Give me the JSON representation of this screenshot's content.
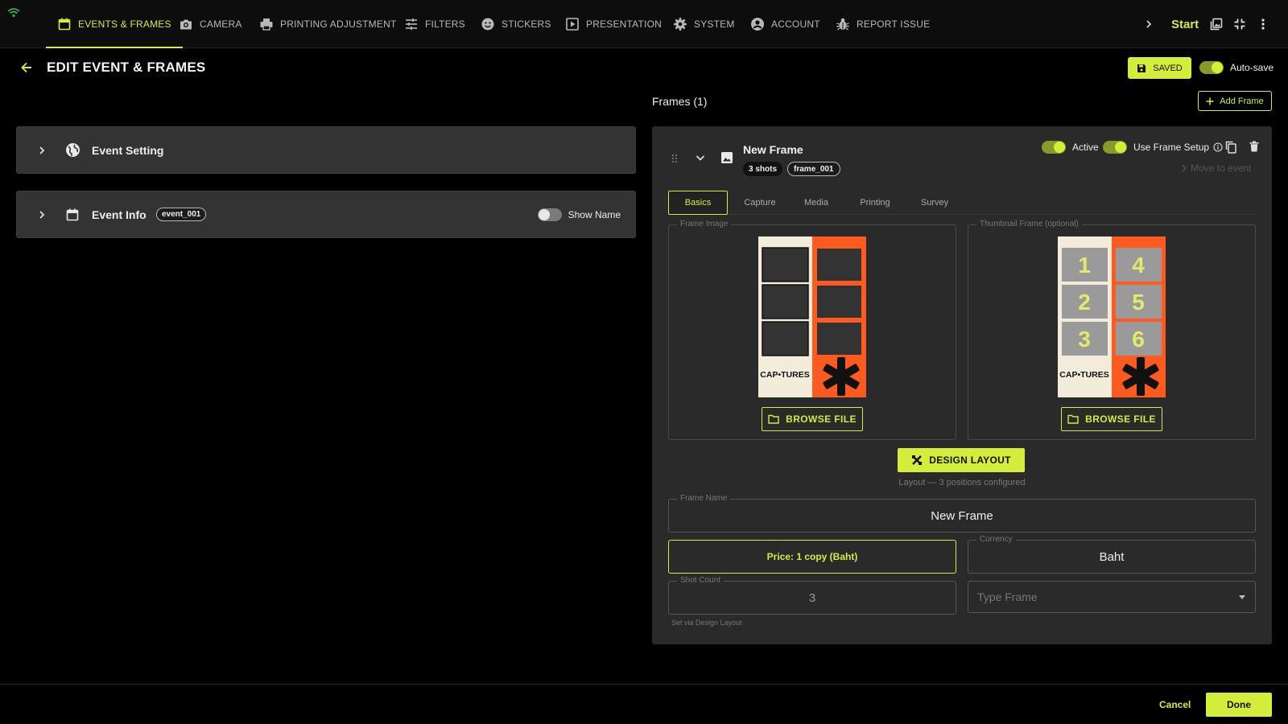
{
  "nav": {
    "items": [
      {
        "label": "EVENTS & FRAMES",
        "icon": "calendar-icon",
        "active": true
      },
      {
        "label": "CAMERA",
        "icon": "camera-icon"
      },
      {
        "label": "PRINTING ADJUSTMENT",
        "icon": "printer-icon"
      },
      {
        "label": "FILTERS",
        "icon": "sliders-icon"
      },
      {
        "label": "STICKERS",
        "icon": "sticker-icon"
      },
      {
        "label": "PRESENTATION",
        "icon": "presentation-icon"
      },
      {
        "label": "SYSTEM",
        "icon": "gear-icon"
      },
      {
        "label": "ACCOUNT",
        "icon": "account-icon"
      },
      {
        "label": "REPORT ISSUE",
        "icon": "bug-icon"
      }
    ],
    "start_label": "Start"
  },
  "header": {
    "title": "EDIT EVENT & FRAMES",
    "saved_label": "SAVED",
    "autosave_label": "Auto-save"
  },
  "left": {
    "event_setting_label": "Event Setting",
    "event_info_label": "Event Info",
    "event_id": "event_001",
    "show_name_label": "Show Name"
  },
  "frames": {
    "title": "Frames (1)",
    "add_label": "Add Frame",
    "frame": {
      "name": "New Frame",
      "shots_chip": "3 shots",
      "id_chip": "frame_001",
      "active_label": "Active",
      "use_setup_label": "Use Frame Setup",
      "move_label": "Move to event",
      "tabs": [
        "Basics",
        "Capture",
        "Media",
        "Printing",
        "Survey"
      ],
      "frame_image_legend": "Frame Image",
      "thumb_legend": "Thumbnail Frame (optional)",
      "browse_label": "BROWSE FILE",
      "brand_text": "CAP•TURES",
      "thumb_numbers": [
        "1",
        "2",
        "3",
        "4",
        "5",
        "6"
      ],
      "design_label": "DESIGN LAYOUT",
      "layout_info": "Layout — 3 positions configured",
      "frame_name_legend": "Frame Name",
      "frame_name_value": "New Frame",
      "price_label": "Price: 1 copy (Baht)",
      "currency_legend": "Currency",
      "currency_value": "Baht",
      "shot_count_legend": "Shot Count",
      "shot_count_value": "3",
      "type_frame_placeholder": "Type Frame",
      "hint": "Set via Design Layout"
    }
  },
  "footer": {
    "cancel_label": "Cancel",
    "done_label": "Done"
  },
  "colors": {
    "accent": "#d4ec3a",
    "orange": "#ff5a1f",
    "cream": "#f3ecdb"
  }
}
